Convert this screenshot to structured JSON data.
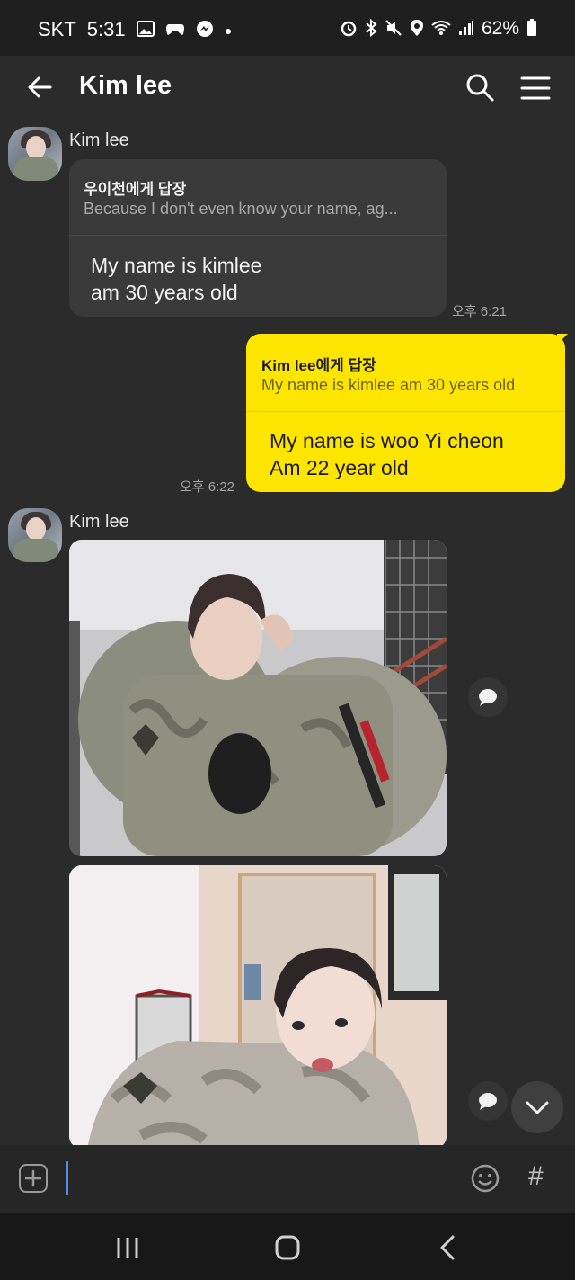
{
  "status_bar": {
    "carrier": "SKT",
    "time": "5:31",
    "battery": "62%",
    "left_icons": [
      "gallery-icon",
      "game-controller-icon",
      "messenger-icon",
      "dot-icon"
    ],
    "right_icons": [
      "alarm-icon",
      "bluetooth-icon",
      "mute-icon",
      "location-icon",
      "wifi-icon",
      "signal-icon",
      "battery-icon"
    ]
  },
  "header": {
    "title": "Kim lee",
    "icons": [
      "back-arrow-icon",
      "search-icon",
      "menu-icon"
    ]
  },
  "messages": [
    {
      "sender": "Kim lee",
      "reply_to": "우이천에게 답장",
      "quoted": "Because I don't even know your name, ag...",
      "lines": [
        "My name is kimlee",
        "am 30 years old"
      ],
      "time": "오후 6:21"
    },
    {
      "reply_to": "Kim lee에게 답장",
      "quoted": "My name is kimlee  am 30 years old",
      "lines": [
        "My name is woo Yi cheon",
        "Am 22 year old"
      ],
      "time": "오후 6:22"
    },
    {
      "sender": "Kim lee",
      "photos": [
        "photo-soldier-selfie",
        "photo-soldier-pout"
      ]
    }
  ],
  "input": {
    "placeholder": "",
    "icons": [
      "plus-icon",
      "emoji-icon",
      "hash-icon"
    ],
    "hash_label": "#"
  },
  "colors": {
    "background": "#2b2b2b",
    "incoming_bubble": "#3a3a3a",
    "outgoing_bubble": "#fee500",
    "caret": "#4a90e2"
  },
  "nav_icons": [
    "recent-apps-icon",
    "home-icon",
    "back-nav-icon"
  ]
}
